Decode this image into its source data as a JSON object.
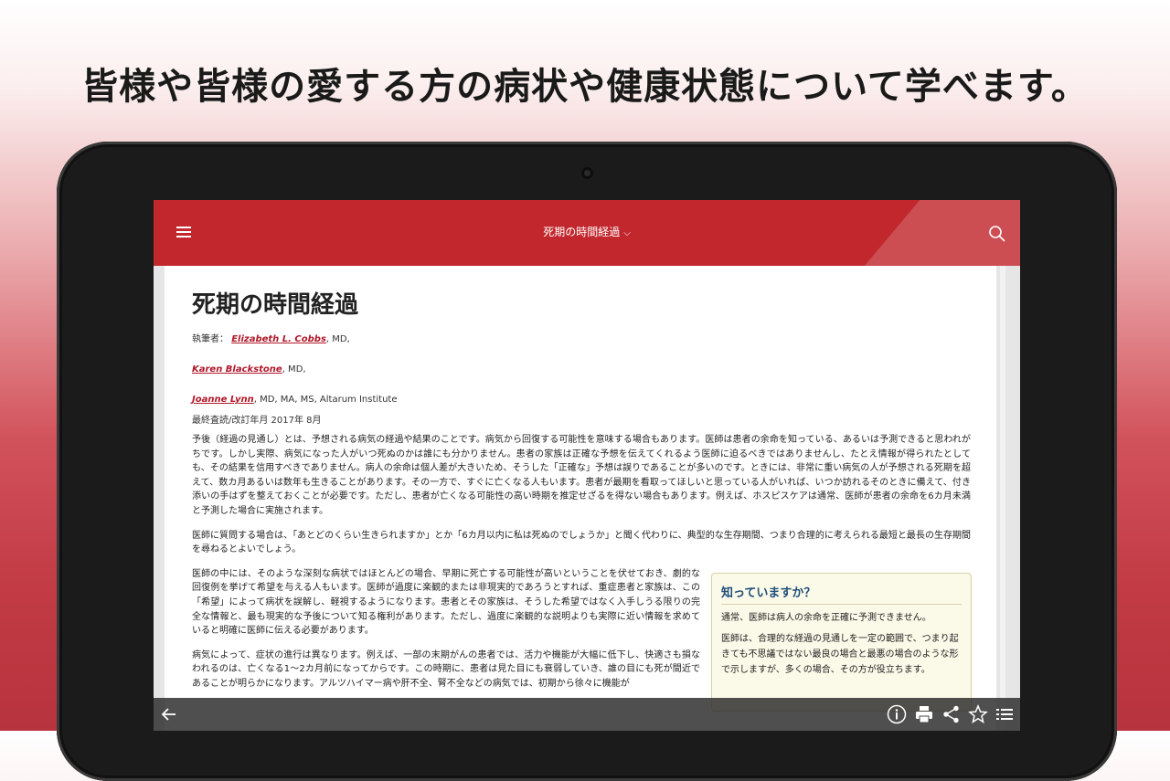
{
  "promo": {
    "headline": "皆様や皆様の愛する方の病状や健康状態について学べます。"
  },
  "appbar": {
    "title": "死期の時間経過",
    "chevron": "⌵",
    "color": "#c1272d"
  },
  "article": {
    "title": "死期の時間経過",
    "author_prefix": "執筆者：",
    "authors": [
      {
        "name": "Elizabeth L. Cobbs",
        "suffix": ", MD,"
      },
      {
        "name": "Karen Blackstone",
        "suffix": ", MD,"
      },
      {
        "name": "Joanne Lynn",
        "suffix": ", MD, MA, MS, Altarum Institute"
      }
    ],
    "reviewed": "最終査読/改訂年月 2017年 8月",
    "para1": "予後（経過の見通し）とは、予想される病気の経過や結果のことです。病気から回復する可能性を意味する場合もあります。医師は患者の余命を知っている、あるいは予測できると思われがちです。しかし実際、病気になった人がいつ死ぬのかは誰にも分かりません。患者の家族は正確な予想を伝えてくれるよう医師に迫るべきではありませんし、たとえ情報が得られたとしても、その結果を信用すべきでありません。病人の余命は個人差が大きいため、そうした「正確な」予想は誤りであることが多いのです。ときには、非常に重い病気の人が予想される死期を超えて、数カ月あるいは数年も生きることがあります。その一方で、すぐに亡くなる人もいます。患者が最期を看取ってほしいと思っている人がいれば、いつか訪れるそのときに備えて、付き添いの手はずを整えておくことが必要です。ただし、患者が亡くなる可能性の高い時期を推定せざるを得ない場合もあります。例えば、ホスピスケアは通常、医師が患者の余命を6カ月未満と予測した場合に実施されます。",
    "para2": "医師に質問する場合は、「あとどのくらい生きられますか」とか「6カ月以内に私は死ぬのでしょうか」と聞く代わりに、典型的な生存期間、つまり合理的に考えられる最短と最長の生存期間を尋ねるとよいでしょう。",
    "para3": "医師の中には、そのような深刻な病状ではほとんどの場合、早期に死亡する可能性が高いということを伏せておき、劇的な回復例を挙げて希望を与える人もいます。医師が過度に楽観的または非現実的であろうとすれば、重症患者と家族は、この「希望」によって病状を誤解し、軽視するようになります。患者とその家族は、そうした希望ではなく入手しうる限りの完全な情報と、最も現実的な予後について知る権利があります。ただし、過度に楽観的な説明よりも実際に近い情報を求めていると明確に医師に伝える必要があります。",
    "para4": "病気によって、症状の進行は異なります。例えば、一部の末期がんの患者では、活力や機能が大幅に低下し、快適さも損なわれるのは、亡くなる1～2カ月前になってからです。この時期に、患者は見た目にも衰弱していき、誰の目にも死が間近であることが明らかになります。アルツハイマー病や肝不全、腎不全などの病気では、初期から徐々に機能が"
  },
  "sidebox": {
    "title": "知っていますか？",
    "line1": "通常、医師は病人の余命を正確に予測できません。",
    "line2": "医師は、合理的な経過の見通しを一定の範囲で、つまり起きても不思議ではない最良の場合と最悪の場合のような形で示しますが、多くの場合、その方が役立ちます。"
  },
  "bottombar": {
    "icons": [
      "back-arrow-icon",
      "info-icon",
      "print-icon",
      "share-icon",
      "star-icon",
      "list-icon"
    ]
  }
}
